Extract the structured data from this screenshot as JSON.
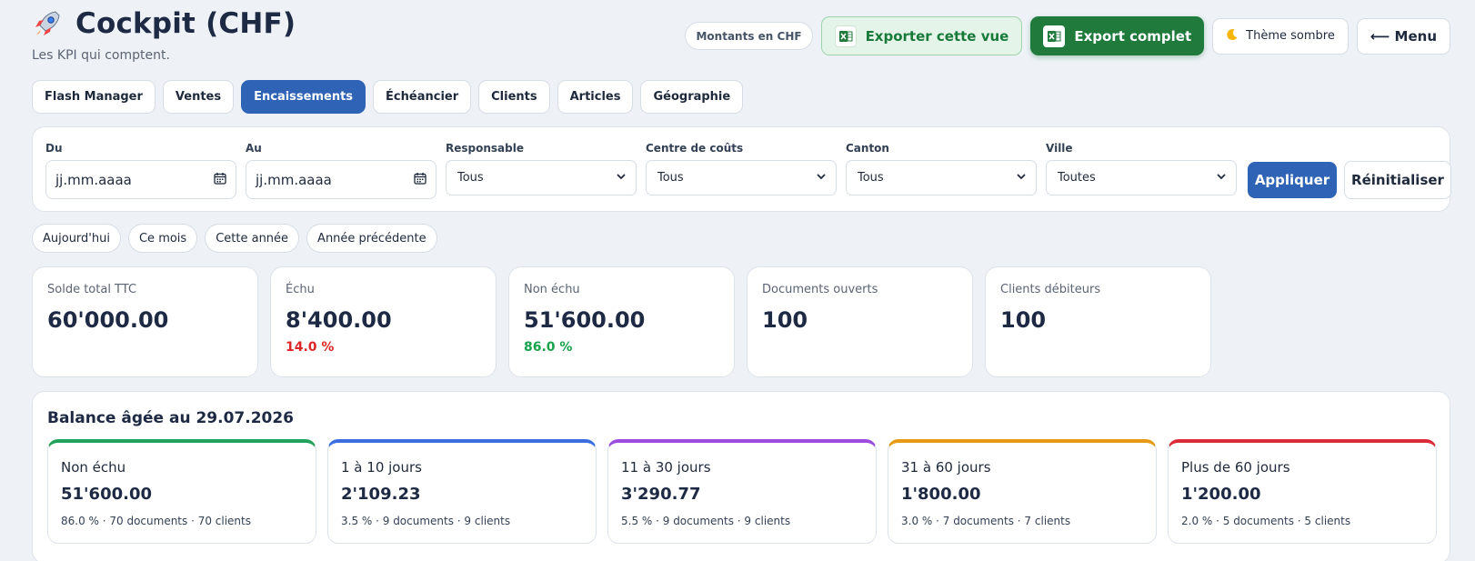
{
  "header": {
    "title": "Cockpit (CHF)",
    "subtitle": "Les KPI qui comptent."
  },
  "actions": {
    "currency_note": "Montants en CHF",
    "export_view": "Exporter cette vue",
    "export_full": "Export complet",
    "dark_theme": "Thème sombre",
    "menu": "⟵ Menu"
  },
  "tabs": [
    {
      "label": "Flash Manager",
      "active": false
    },
    {
      "label": "Ventes",
      "active": false
    },
    {
      "label": "Encaissements",
      "active": true
    },
    {
      "label": "Échéancier",
      "active": false
    },
    {
      "label": "Clients",
      "active": false
    },
    {
      "label": "Articles",
      "active": false
    },
    {
      "label": "Géographie",
      "active": false
    }
  ],
  "filters": {
    "from": {
      "label": "Du",
      "placeholder": "jj.mm.aaaa"
    },
    "to": {
      "label": "Au",
      "placeholder": "jj.mm.aaaa"
    },
    "responsible": {
      "label": "Responsable",
      "value": "Tous"
    },
    "cost_center": {
      "label": "Centre de coûts",
      "value": "Tous"
    },
    "canton": {
      "label": "Canton",
      "value": "Tous"
    },
    "city": {
      "label": "Ville",
      "value": "Toutes"
    },
    "apply": "Appliquer",
    "reset": "Réinitialiser"
  },
  "quick_ranges": [
    "Aujourd'hui",
    "Ce mois",
    "Cette année",
    "Année précédente"
  ],
  "kpis": [
    {
      "label": "Solde total TTC",
      "value": "60'000.00",
      "pct": ""
    },
    {
      "label": "Échu",
      "value": "8'400.00",
      "pct": "14.0 %",
      "pct_color": "#dc2626"
    },
    {
      "label": "Non échu",
      "value": "51'600.00",
      "pct": "86.0 %",
      "pct_color": "#16a34a"
    },
    {
      "label": "Documents ouverts",
      "value": "100",
      "pct": ""
    },
    {
      "label": "Clients débiteurs",
      "value": "100",
      "pct": ""
    }
  ],
  "aging": {
    "title": "Balance âgée au 29.07.2026",
    "buckets": [
      {
        "label": "Non échu",
        "value": "51'600.00",
        "meta": "86.0 % · 70 documents · 70 clients",
        "color": "#22a25a"
      },
      {
        "label": "1 à 10 jours",
        "value": "2'109.23",
        "meta": "3.5 % · 9 documents · 9 clients",
        "color": "#3b6fe0"
      },
      {
        "label": "11 à 30 jours",
        "value": "3'290.77",
        "meta": "5.5 % · 9 documents · 9 clients",
        "color": "#9b4de0"
      },
      {
        "label": "31 à 60 jours",
        "value": "1'800.00",
        "meta": "3.0 % · 7 documents · 7 clients",
        "color": "#e69a17"
      },
      {
        "label": "Plus de 60 jours",
        "value": "1'200.00",
        "meta": "2.0 % · 5 documents · 5 clients",
        "color": "#dc2b3b"
      }
    ]
  },
  "colors": {
    "accent": "#2f63b6",
    "excel_green": "#1f7a3c",
    "background": "#eef2f7"
  },
  "icons": {
    "title": "rocket-icon",
    "export": "excel-icon",
    "theme": "moon-icon",
    "date": "calendar-icon",
    "select": "chevron-down-icon"
  }
}
